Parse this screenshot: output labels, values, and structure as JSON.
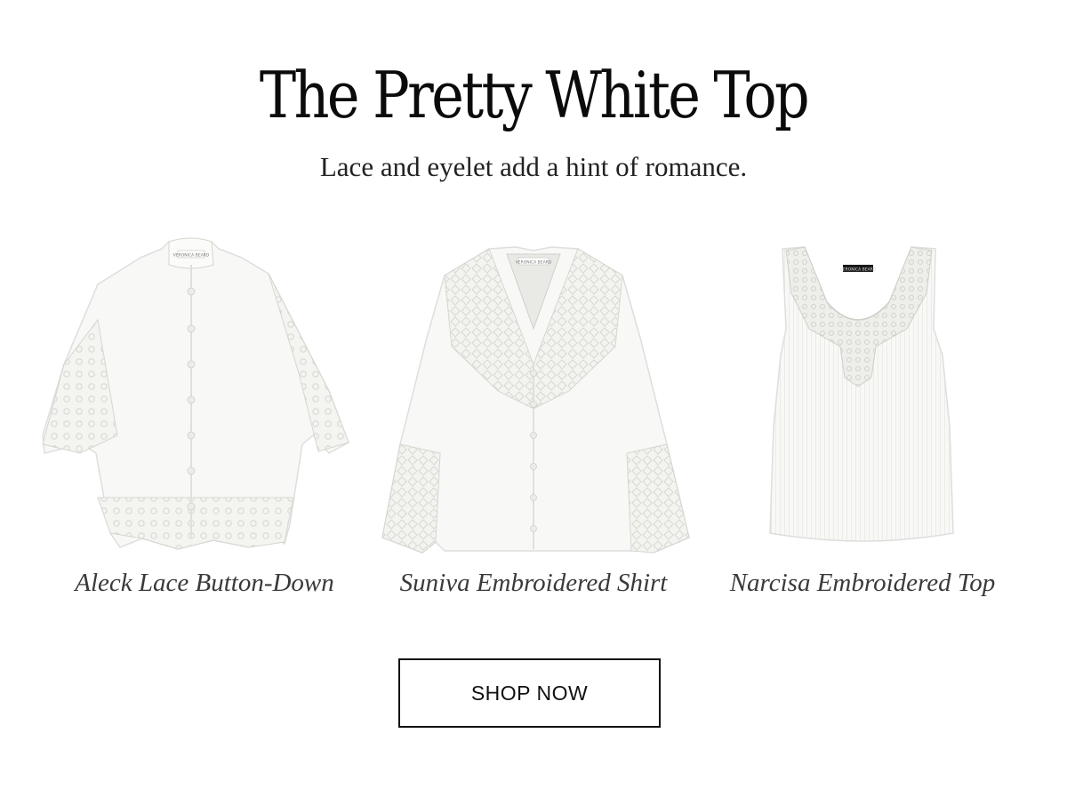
{
  "header": {
    "title": "The Pretty White Top",
    "subtitle": "Lace and eyelet add a hint of romance."
  },
  "products": [
    {
      "name": "Aleck Lace Button-Down",
      "image": "white-short-sleeve-lace-button-down-shirt",
      "label_text": "VERONICA BEARD"
    },
    {
      "name": "Suniva Embroidered Shirt",
      "image": "white-long-sleeve-embroidered-v-neck-shirt",
      "label_text": "VERONICA BEARD"
    },
    {
      "name": "Narcisa Embroidered Top",
      "image": "white-ribbed-tank-with-embroidered-neckline",
      "label_text": "VERONICA BEARD"
    }
  ],
  "cta": {
    "label": "SHOP NOW"
  },
  "colors": {
    "background": "#ffffff",
    "text": "#111111",
    "garment": "#f7f7f5",
    "garment_shadow": "#dcdcd8",
    "lace": "#e8e8e4"
  }
}
